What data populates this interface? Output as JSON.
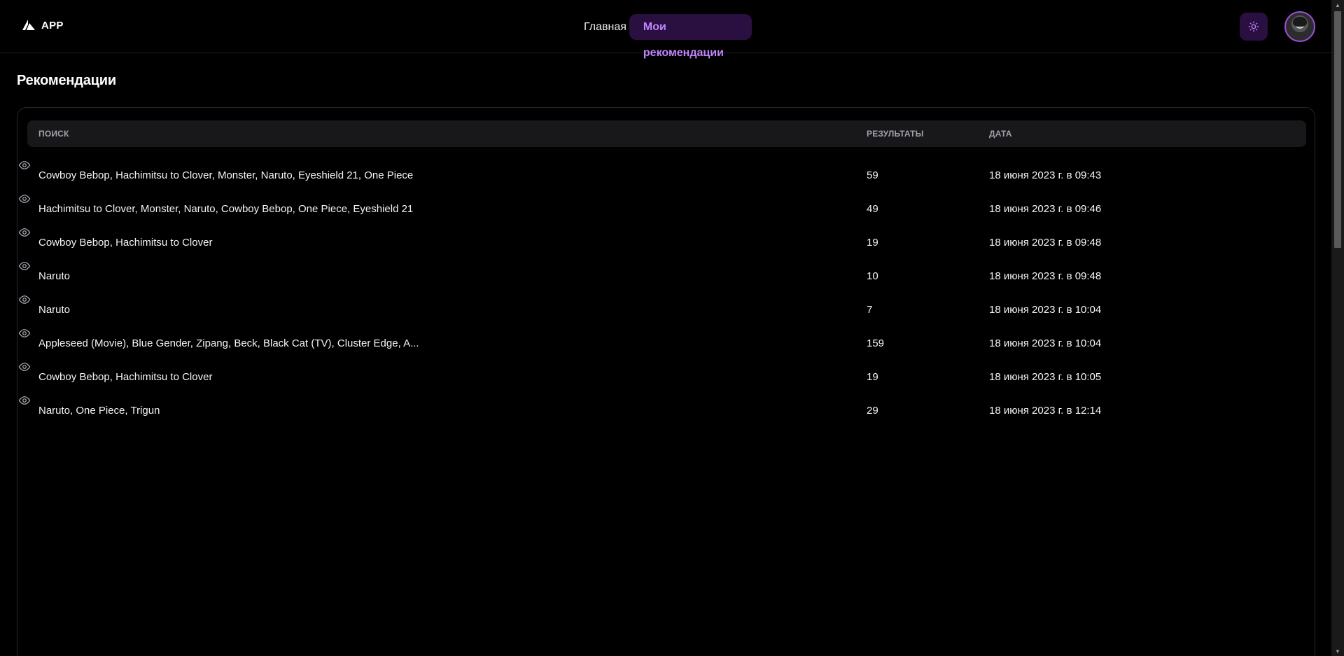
{
  "header": {
    "brand": "APP",
    "nav": [
      {
        "label": "Главная",
        "active": false
      },
      {
        "label": "Мои рекомендации",
        "active": true
      }
    ],
    "theme_icon": "sun-icon",
    "avatar_icon": "user-avatar"
  },
  "page": {
    "title": "Рекомендации"
  },
  "table": {
    "columns": [
      "ПОИСК",
      "РЕЗУЛЬТАТЫ",
      "ДАТА"
    ],
    "rows": [
      {
        "search": "Cowboy Bebop, Hachimitsu to Clover, Monster, Naruto, Eyeshield 21, One Piece",
        "results": "59",
        "date": "18 июня 2023 г. в 09:43"
      },
      {
        "search": "Hachimitsu to Clover, Monster, Naruto, Cowboy Bebop, One Piece, Eyeshield 21",
        "results": "49",
        "date": "18 июня 2023 г. в 09:46"
      },
      {
        "search": "Cowboy Bebop, Hachimitsu to Clover",
        "results": "19",
        "date": "18 июня 2023 г. в 09:48"
      },
      {
        "search": "Naruto",
        "results": "10",
        "date": "18 июня 2023 г. в 09:48"
      },
      {
        "search": "Naruto",
        "results": "7",
        "date": "18 июня 2023 г. в 10:04"
      },
      {
        "search": "Appleseed (Movie), Blue Gender, Zipang, Beck, Black Cat (TV), Cluster Edge, A...",
        "results": "159",
        "date": "18 июня 2023 г. в 10:04"
      },
      {
        "search": "Cowboy Bebop, Hachimitsu to Clover",
        "results": "19",
        "date": "18 июня 2023 г. в 10:05"
      },
      {
        "search": "Naruto, One Piece, Trigun",
        "results": "29",
        "date": "18 июня 2023 г. в 12:14"
      }
    ],
    "row_action_icon": "eye-icon"
  },
  "colors": {
    "background": "#000000",
    "accent": "#c084fc",
    "accent_bg": "#2a1040",
    "header_row_bg": "#18181b"
  }
}
